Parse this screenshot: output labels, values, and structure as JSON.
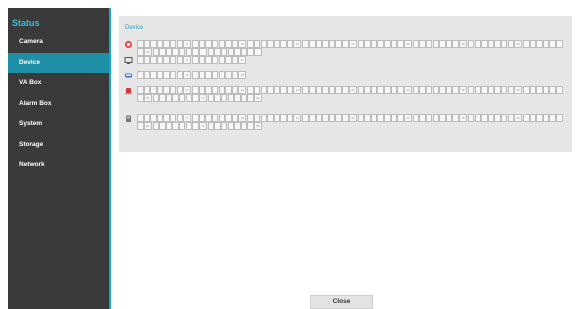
{
  "sidebar": {
    "title": "Status",
    "items": [
      {
        "label": "Camera",
        "active": false
      },
      {
        "label": "Device",
        "active": true
      },
      {
        "label": "VA Box",
        "active": false
      },
      {
        "label": "Alarm Box",
        "active": false
      },
      {
        "label": "System",
        "active": false
      },
      {
        "label": "Storage",
        "active": false
      },
      {
        "label": "Network",
        "active": false
      }
    ]
  },
  "panel": {
    "title": "Device",
    "rows": [
      {
        "icon": "camera-icon",
        "cells": 80,
        "markers": [
          "8",
          "16",
          "24",
          "32",
          "40",
          "48",
          "56",
          "64"
        ]
      },
      {
        "icon": "monitor-icon",
        "cells": 16,
        "markers": [
          "8",
          "16"
        ]
      },
      {
        "icon": "car-icon",
        "cells": 16,
        "markers": [
          "8",
          "16"
        ]
      },
      {
        "icon": "alarm-icon",
        "cells": 80,
        "markers": [
          "8",
          "16",
          "24",
          "32",
          "40",
          "48",
          "56",
          "64",
          "72",
          "80"
        ]
      },
      {
        "icon": "recorder-icon",
        "cells": 80,
        "markers": [
          "8",
          "16",
          "24",
          "32",
          "40",
          "48",
          "56",
          "64",
          "72",
          "80"
        ]
      }
    ]
  },
  "footer": {
    "close_label": "Close"
  },
  "colors": {
    "accent": "#1e8fa5",
    "title": "#2fc0db",
    "sidebar": "#3a3a3a"
  }
}
